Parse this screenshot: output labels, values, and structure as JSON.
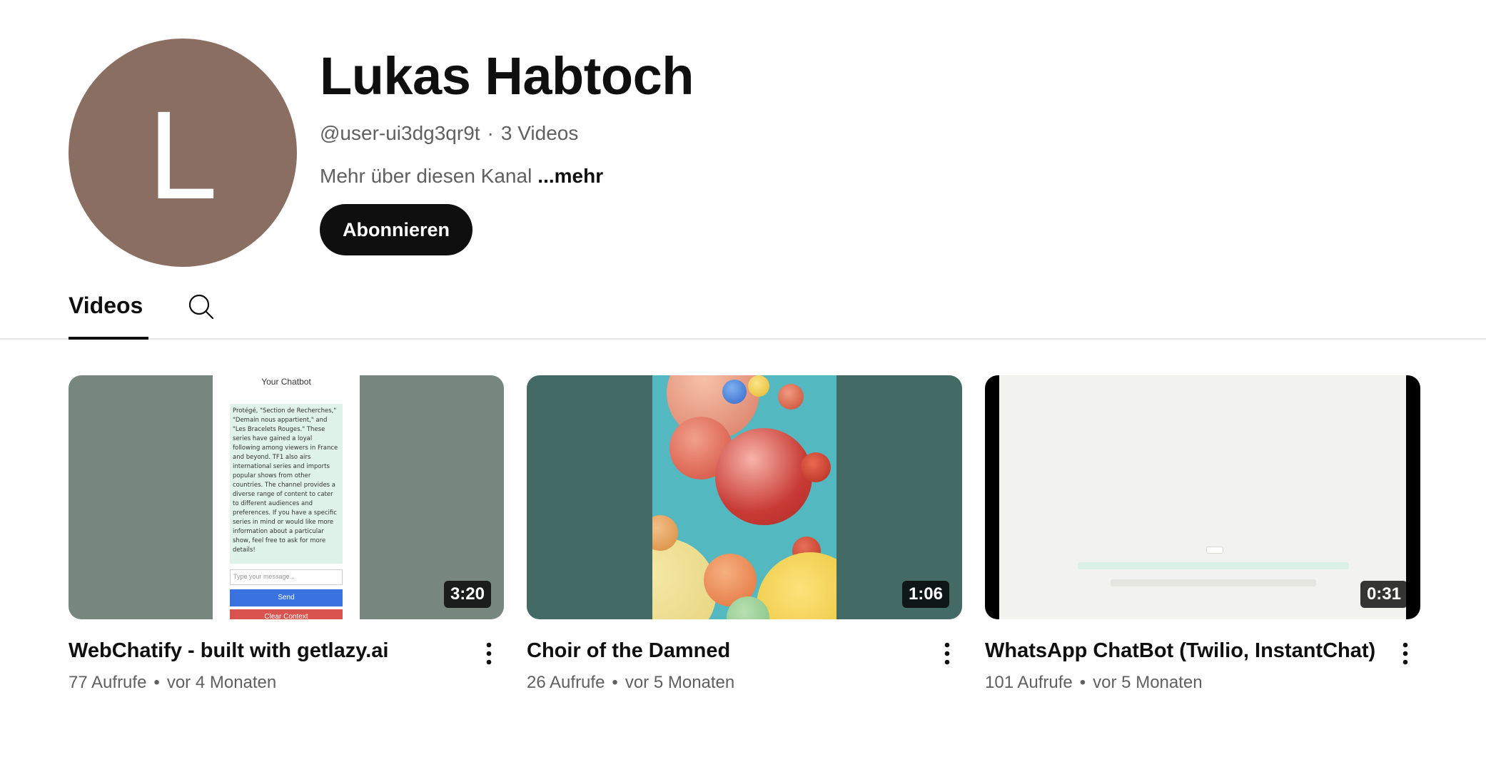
{
  "channel": {
    "avatar_letter": "L",
    "avatar_color": "#8b6e62",
    "name": "Lukas Habtoch",
    "handle": "@user-ui3dg3qr9t",
    "separator": "·",
    "video_count": "3 Videos",
    "description": "Mehr über diesen Kanal",
    "more_label": "...mehr",
    "subscribe_label": "Abonnieren"
  },
  "tabs": {
    "videos_label": "Videos",
    "search_icon": "search-icon"
  },
  "stats_separator": "•",
  "videos": [
    {
      "title": "WebChatify - built with getlazy.ai",
      "views": "77 Aufrufe",
      "age": "vor 4 Monaten",
      "duration": "3:20",
      "thumb": {
        "header": "Your Chatbot",
        "message": "Protégé, \"Section de Recherches,\" \"Demain nous appartient,\" and \"Les Bracelets Rouges.\" These series have gained a loyal following among viewers in France and beyond. TF1 also airs international series and imports popular shows from other countries. The channel provides a diverse range of content to cater to different audiences and preferences. If you have a specific series in mind or would like more information about a particular show, feel free to ask for more details!",
        "input_placeholder": "Type your message...",
        "send_label": "Send",
        "clear_label": "Clear Context"
      }
    },
    {
      "title": "Choir of the Damned",
      "views": "26 Aufrufe",
      "age": "vor 5 Monaten",
      "duration": "1:06"
    },
    {
      "title": "WhatsApp ChatBot (Twilio, InstantChat)",
      "views": "101 Aufrufe",
      "age": "vor 5 Monaten",
      "duration": "0:31"
    }
  ]
}
